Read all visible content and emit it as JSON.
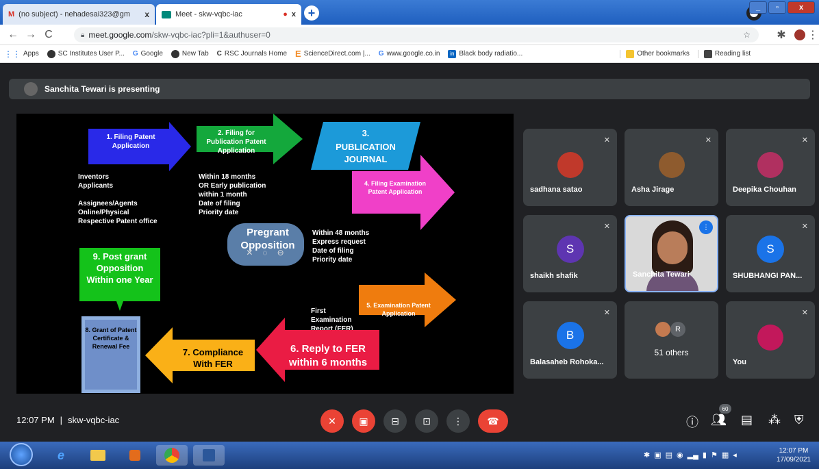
{
  "browser": {
    "tabs": [
      {
        "label": "(no subject) - nehadesai323@gm",
        "close": "x",
        "icon": "gmail-icon"
      },
      {
        "label": "Meet - skw-vqbc-iac",
        "close": "x",
        "icon": "meet-icon",
        "recording": "●"
      }
    ],
    "new_tab": "+",
    "url_host": "meet.google.com",
    "url_path": "/skw-vqbc-iac?pli=1&authuser=0",
    "bookmarks": [
      "Apps",
      "SC Institutes User P...",
      "Google",
      "New Tab",
      "RSC Journals Home",
      "ScienceDirect.com |...",
      "www.google.co.in",
      "Black body radiatio..."
    ],
    "other_bookmarks": "Other bookmarks",
    "reading_list": "Reading list"
  },
  "meet": {
    "presenting_banner": "Sanchita Tewari is presenting",
    "meeting_time": "12:07 PM",
    "separator": "|",
    "meeting_code": "skw-vqbc-iac",
    "people_count": "60",
    "slide": {
      "step1": "1. Filing Patent Application",
      "step2": "2. Filing for Publication Patent Application",
      "step3_num": "3.",
      "step3": "PUBLICATION JOURNAL",
      "step4": "4. Filing Examination Patent Application",
      "step5": "5. Examination Patent Application",
      "step6": "6. Reply to FER within 6 months",
      "step7": "7. Compliance With FER",
      "step8": "8. Grant of Patent Certificate & Renewal Fee",
      "step9": "9. Post grant Opposition Within one Year",
      "pregrant": "Pregrant Opposition",
      "col1": [
        "Inventors",
        "Applicants",
        "",
        "Assignees/Agents",
        "Online/Physical",
        "Respective Patent office"
      ],
      "col2": [
        "Within 18 months",
        "OR Early publication",
        "within 1 month",
        "Date of filing",
        "Priority date"
      ],
      "col3": [
        "Within 48 months",
        "Express request",
        "Date of filing",
        "Priority date"
      ],
      "col4": [
        "First",
        "Examination",
        "Report (FER)"
      ]
    },
    "participants": [
      {
        "name": "sadhana satao",
        "type": "photo",
        "color": "#c0392b"
      },
      {
        "name": "Asha Jirage",
        "type": "photo",
        "color": "#8e5b2e"
      },
      {
        "name": "Deepika Chouhan",
        "type": "photo",
        "color": "#b03060"
      },
      {
        "name": "shaikh shafik",
        "type": "letter",
        "letter": "S",
        "color": "#5e35b1"
      },
      {
        "name": "Sanchita Tewari",
        "type": "video",
        "color": "#d9d9d9"
      },
      {
        "name": "SHUBHANGI PAN...",
        "type": "letter",
        "letter": "S",
        "color": "#1a73e8"
      },
      {
        "name": "Balasaheb Rohoka...",
        "type": "letter",
        "letter": "B",
        "color": "#1a73e8"
      },
      {
        "name": "51 others",
        "type": "group",
        "letter": "R",
        "color": "#5f6368"
      },
      {
        "name": "You",
        "type": "photo",
        "color": "#c2185b"
      }
    ]
  },
  "taskbar": {
    "time": "12:07 PM",
    "date": "17/09/2021"
  }
}
